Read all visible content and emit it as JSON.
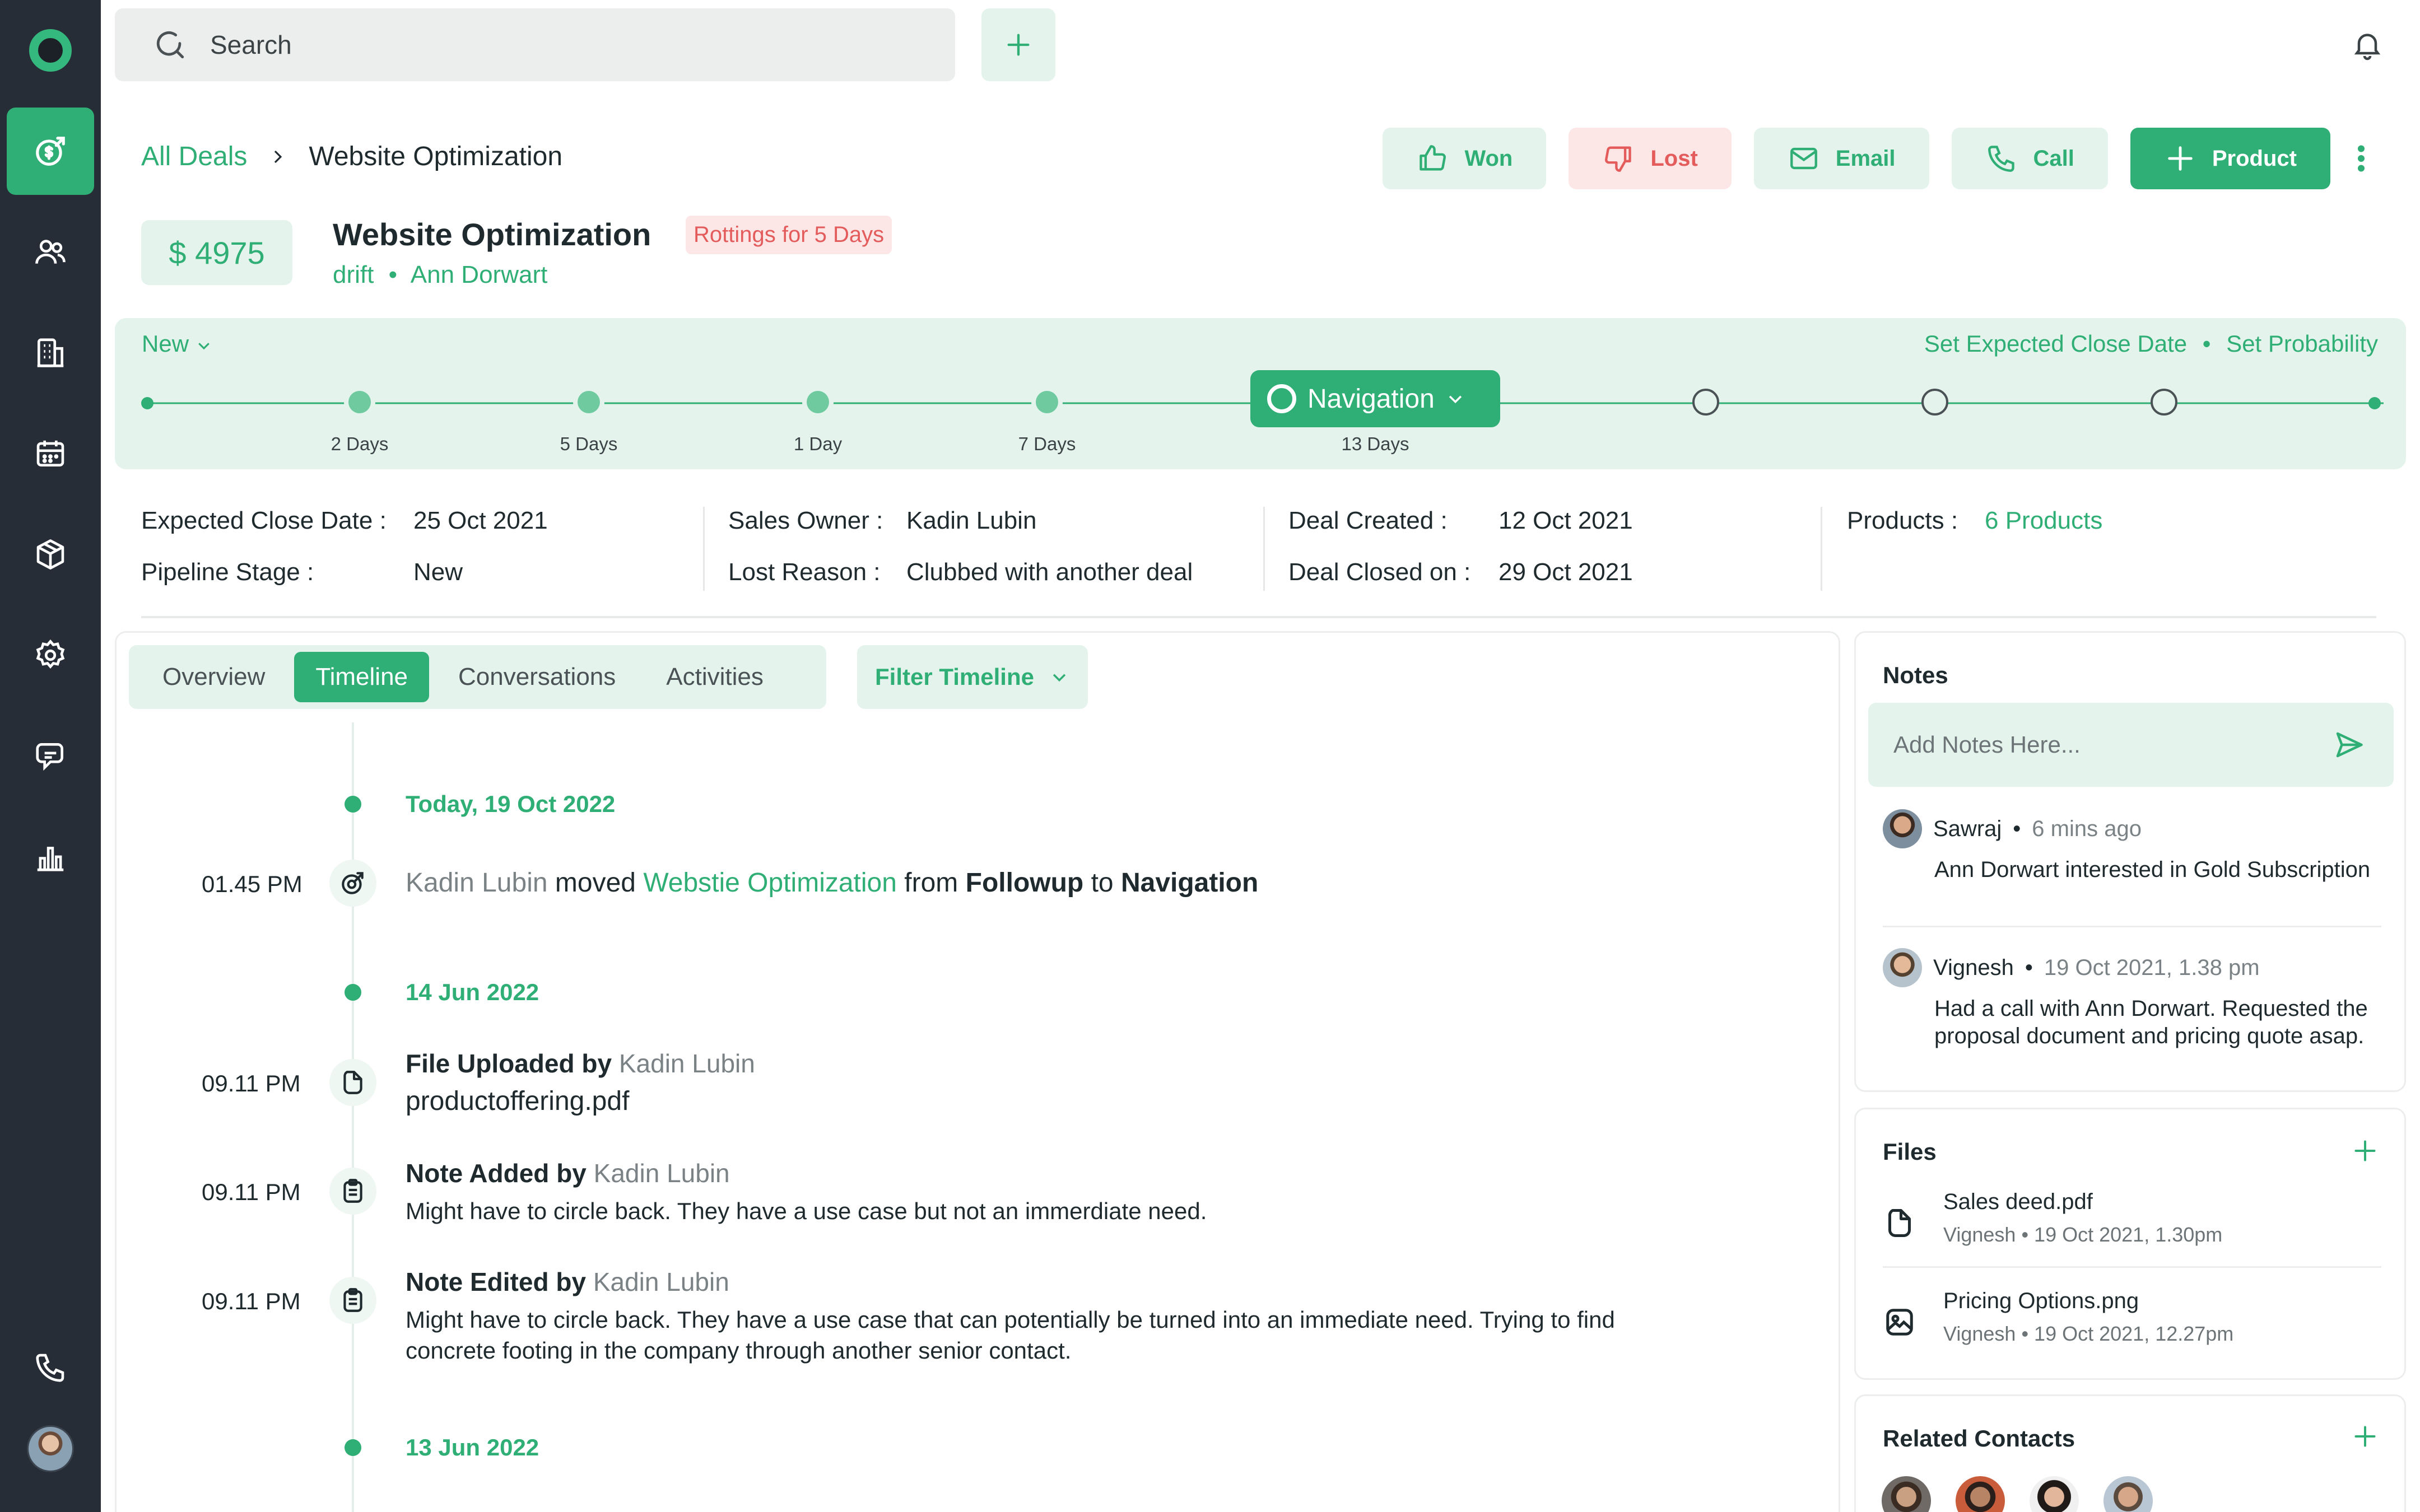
{
  "topbar": {
    "search_placeholder": "Search"
  },
  "breadcrumb": {
    "root": "All Deals",
    "current": "Website Optimization"
  },
  "actions": {
    "won": "Won",
    "lost": "Lost",
    "email": "Email",
    "call": "Call",
    "product": "Product"
  },
  "deal": {
    "amount": "$ 4975",
    "title": "Website Optimization",
    "rotting_badge": "Rottings for 5 Days",
    "company": "drift",
    "separator": "•",
    "contact": "Ann Dorwart"
  },
  "pipeline": {
    "stage_select": "New",
    "set_close_date": "Set Expected Close Date",
    "link_separator": "•",
    "set_probability": "Set Probability",
    "current_stage": "Navigation",
    "labels": [
      "2 Days",
      "5 Days",
      "1 Day",
      "7 Days",
      "13 Days"
    ],
    "steps_completed": 5,
    "steps_total": 9
  },
  "info": {
    "expected_close_label": "Expected Close Date :",
    "expected_close_value": "25 Oct 2021",
    "pipeline_stage_label": "Pipeline Stage :",
    "pipeline_stage_value": "New",
    "sales_owner_label": "Sales Owner :",
    "sales_owner_value": "Kadin Lubin",
    "lost_reason_label": "Lost Reason :",
    "lost_reason_value": "Clubbed with another deal",
    "deal_created_label": "Deal Created :",
    "deal_created_value": "12 Oct 2021",
    "deal_closed_label": "Deal Closed on :",
    "deal_closed_value": "29 Oct 2021",
    "products_label": "Products :",
    "products_value": "6 Products"
  },
  "tabs": [
    "Overview",
    "Timeline",
    "Conversations",
    "Activities"
  ],
  "filter_label": "Filter Timeline",
  "timeline": {
    "date1": "Today, 19 Oct 2022",
    "e1_time": "01.45 PM",
    "e1_user": "Kadin Lubin",
    "e1_moved": "moved",
    "e1_deal": "Webstie Optimization",
    "e1_from": "from",
    "e1_from_stage": "Followup",
    "e1_to": "to",
    "e1_to_stage": "Navigation",
    "date2": "14 Jun 2022",
    "e2_time": "09.11 PM",
    "e2_action": "File Uploaded",
    "e2_by": "by",
    "e2_user": "Kadin Lubin",
    "e2_file": "productoffering.pdf",
    "e3_time": "09.11 PM",
    "e3_action": "Note Added",
    "e3_by": "by",
    "e3_user": "Kadin Lubin",
    "e3_body": "Might have to circle back. They have a use case but not an immerdiate need.",
    "e4_time": "09.11 PM",
    "e4_action": "Note Edited",
    "e4_by": "by",
    "e4_user": "Kadin Lubin",
    "e4_body": "Might have to circle back. They have a use case that can potentially be turned into an immediate need. Trying to find concrete footing in the company through another senior contact.",
    "date3": "13 Jun 2022"
  },
  "notes": {
    "title": "Notes",
    "placeholder": "Add Notes Here...",
    "items": [
      {
        "author": "Sawraj",
        "sep": "•",
        "time": "6 mins ago",
        "text": "Ann Dorwart interested in Gold Subscription"
      },
      {
        "author": "Vignesh",
        "sep": "•",
        "time": "19 Oct 2021, 1.38 pm",
        "text": "Had a call with Ann Dorwart. Requested the proposal document and pricing quote asap."
      }
    ]
  },
  "files": {
    "title": "Files",
    "items": [
      {
        "name": "Sales deed.pdf",
        "meta": "Vignesh  •  19 Oct 2021, 1.30pm"
      },
      {
        "name": "Pricing Options.png",
        "meta": "Vignesh  •  19 Oct 2021, 12.27pm"
      }
    ]
  },
  "related_contacts": {
    "title": "Related Contacts"
  },
  "colors": {
    "accent": "#2fae75",
    "accent_light": "#e4f4ec",
    "danger": "#e35b5b",
    "sidebar": "#262d36"
  },
  "icons": {
    "sidebar": [
      "deals-icon",
      "contacts-icon",
      "company-icon",
      "calendar-icon",
      "products-icon",
      "settings-icon",
      "chat-icon",
      "reports-icon",
      "phone-icon"
    ]
  }
}
